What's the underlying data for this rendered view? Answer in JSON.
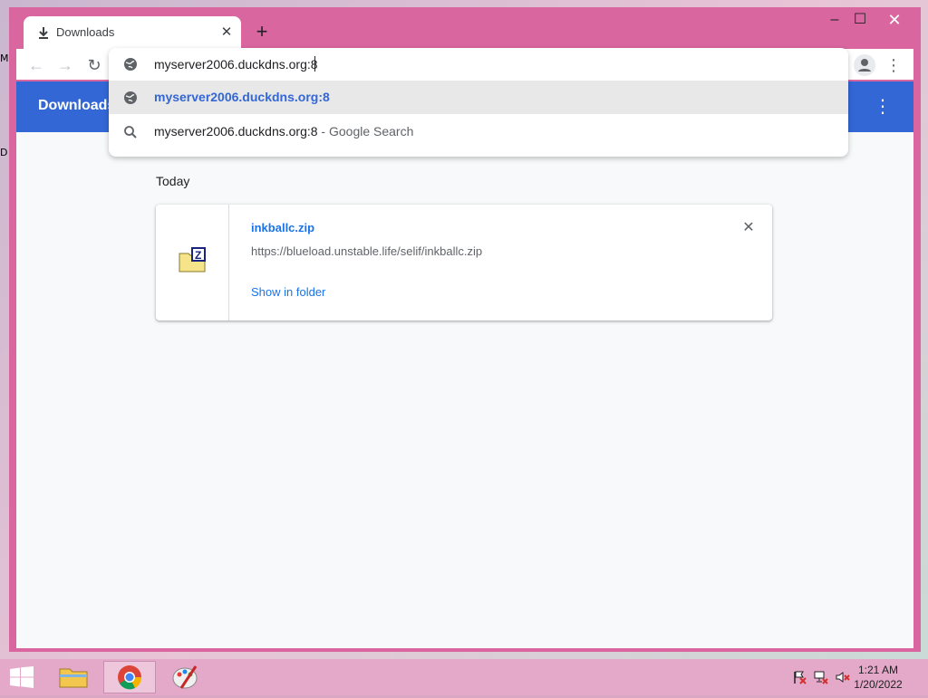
{
  "window": {
    "tab": {
      "title": "Downloads",
      "icon": "download-icon",
      "close": "✕"
    },
    "new_tab": "+",
    "controls": {
      "minimize": "–",
      "maximize": "☐",
      "close": "✕"
    }
  },
  "toolbar": {
    "back": "←",
    "forward": "→",
    "reload": "↻",
    "menu": "⋮"
  },
  "omnibox": {
    "input_value": "myserver2006.duckdns.org:8",
    "suggestions": [
      {
        "icon": "globe-icon",
        "text": "myserver2006.duckdns.org:8",
        "sub": ""
      },
      {
        "icon": "search-icon",
        "text": "myserver2006.duckdns.org:8",
        "sub": " - Google Search"
      }
    ]
  },
  "page": {
    "header_title": "Downloads",
    "menu": "⋮",
    "section": "Today",
    "download": {
      "file_name": "inkballc.zip",
      "url": "https://blueload.unstable.life/selif/inkballc.zip",
      "action": "Show in folder",
      "remove": "✕"
    }
  },
  "taskbar": {
    "items": [
      {
        "name": "file-explorer",
        "icon": "folder-icon"
      },
      {
        "name": "chrome",
        "icon": "chrome-icon"
      },
      {
        "name": "paint",
        "icon": "paint-icon"
      }
    ],
    "clock": {
      "time": "1:21 AM",
      "date": "1/20/2022"
    }
  },
  "colors": {
    "frame": "#d9669f",
    "header_blue": "#3367d6",
    "link_blue": "#1a73e8",
    "taskbar": "#e4a8c8"
  }
}
